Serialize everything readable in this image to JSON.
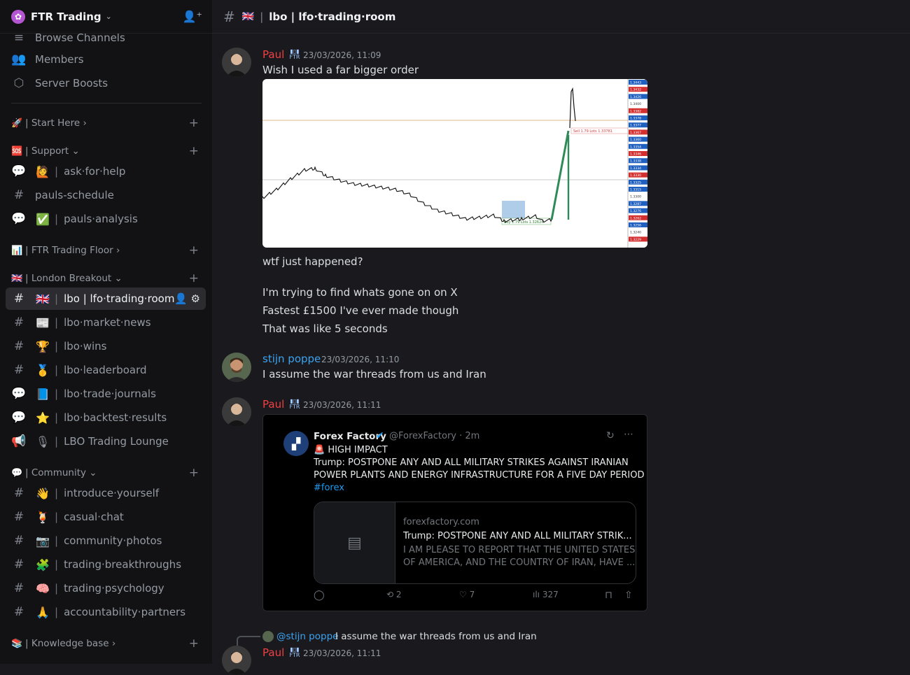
{
  "server": {
    "name": "FTR Trading",
    "logo_glyph": "✿"
  },
  "sidebar": {
    "top_items": [
      {
        "label": "Browse Channels",
        "icon": "browse-icon"
      },
      {
        "label": "Members",
        "icon": "members-icon"
      },
      {
        "label": "Server Boosts",
        "icon": "boost-icon"
      }
    ],
    "categories": {
      "start_here": {
        "emoji": "🚀",
        "label": "Start Here"
      },
      "support": {
        "emoji": "🆘",
        "label": "Support"
      },
      "trading_floor": {
        "emoji": "📊",
        "label": "FTR Trading Floor"
      },
      "london_breakout": {
        "emoji": "🇬🇧",
        "label": "London Breakout"
      },
      "community": {
        "emoji": "💬",
        "label": "Community"
      },
      "knowledge_base": {
        "emoji": "📚",
        "label": "Knowledge base"
      }
    },
    "channels": {
      "ask_for_help": {
        "emoji": "🙋",
        "label": "ask·for·help"
      },
      "pauls_schedule": {
        "label": "pauls-schedule"
      },
      "pauls_analysis": {
        "emoji": "✅",
        "label": "pauls·analysis"
      },
      "lfo_trading_room": {
        "emoji": "🇬🇧",
        "label": "lbo  |  lfo·trading·room"
      },
      "lbo_market_news": {
        "emoji": "📰",
        "label": "lbo·market·news"
      },
      "lbo_wins": {
        "emoji": "🏆",
        "label": "lbo·wins"
      },
      "lbo_leaderboard": {
        "emoji": "🥇",
        "label": "lbo·leaderboard"
      },
      "lbo_trade_journals": {
        "emoji": "📘",
        "label": "lbo·trade·journals"
      },
      "lbo_backtest_results": {
        "emoji": "⭐",
        "label": "lbo·backtest·results"
      },
      "lbo_trading_lounge": {
        "emoji": "🎙",
        "label": "LBO Trading Lounge"
      },
      "introduce_yourself": {
        "emoji": "👋",
        "label": "introduce·yourself"
      },
      "casual_chat": {
        "emoji": "🍹",
        "label": "casual·chat"
      },
      "community_photos": {
        "emoji": "📷",
        "label": "community·photos"
      },
      "trading_breakthroughs": {
        "emoji": "🧩",
        "label": "trading·breakthroughs"
      },
      "trading_psychology": {
        "emoji": "🧠",
        "label": "trading·psychology"
      },
      "accountability_partners": {
        "emoji": "🙏",
        "label": "accountability·partners"
      }
    }
  },
  "header": {
    "flag": "🇬🇧",
    "title": "lbo  |  lfo·trading·room"
  },
  "messages": {
    "m1": {
      "author": "Paul",
      "author_color": "#f23f42",
      "badge": "FTR",
      "timestamp": "23/03/2026, 11:09",
      "lines": [
        "Wish I used a far bigger order",
        "wtf just happened?",
        "I'm trying to find whats gone on on X",
        "Fastest £1500 I've ever made though",
        "That was like 5 seconds"
      ]
    },
    "m2": {
      "author": "stijn poppe",
      "author_color": "#3ba3f0",
      "timestamp": "23/03/2026, 11:10",
      "text": "I assume the war threads from us and Iran"
    },
    "m3": {
      "author": "Paul",
      "badge": "FTR",
      "timestamp": "23/03/2026, 11:11"
    },
    "m4": {
      "reply_mention": "@stijn poppe",
      "reply_text": "I assume the war threads from us and Iran",
      "author": "Paul",
      "badge": "FTR",
      "timestamp": "23/03/2026, 11:11"
    }
  },
  "chart_image": {
    "price_labels": [
      "1.3443",
      "1.3432",
      "1.3426",
      "1.3400",
      "1.3382",
      "1.3378",
      "1.3377",
      "1.3367",
      "1.3360",
      "1.3354",
      "1.3346",
      "1.3338",
      "1.3334",
      "1.3330",
      "1.3325",
      "1.3315",
      "1.3300",
      "1.3287",
      "1.3276",
      "1.3262",
      "1.3256",
      "1.3240",
      "1.3229"
    ],
    "buy_label": "Buy  1.79 Lots  1.32624",
    "sell_label": "Sell  1.79 Lots  1.33781"
  },
  "tweet": {
    "name": "Forex Factory",
    "handle": "@ForexFactory · 2m",
    "alert": "🚨 HIGH IMPACT",
    "body_line1": "Trump:  POSTPONE ANY AND ALL MILITARY STRIKES AGAINST IRANIAN",
    "body_line2": "POWER PLANTS AND ENERGY INFRASTRUCTURE FOR A FIVE DAY PERIOD",
    "hashtag": "#forex",
    "card_domain": "forexfactory.com",
    "card_title": "Trump: POSTPONE ANY AND ALL MILITARY STRIK...",
    "card_desc1": "I AM PLEASE TO REPORT THAT THE UNITED STATES",
    "card_desc2": "OF AMERICA, AND THE COUNTRY OF IRAN, HAVE ...",
    "retweets": "2",
    "likes": "7",
    "views": "327"
  }
}
